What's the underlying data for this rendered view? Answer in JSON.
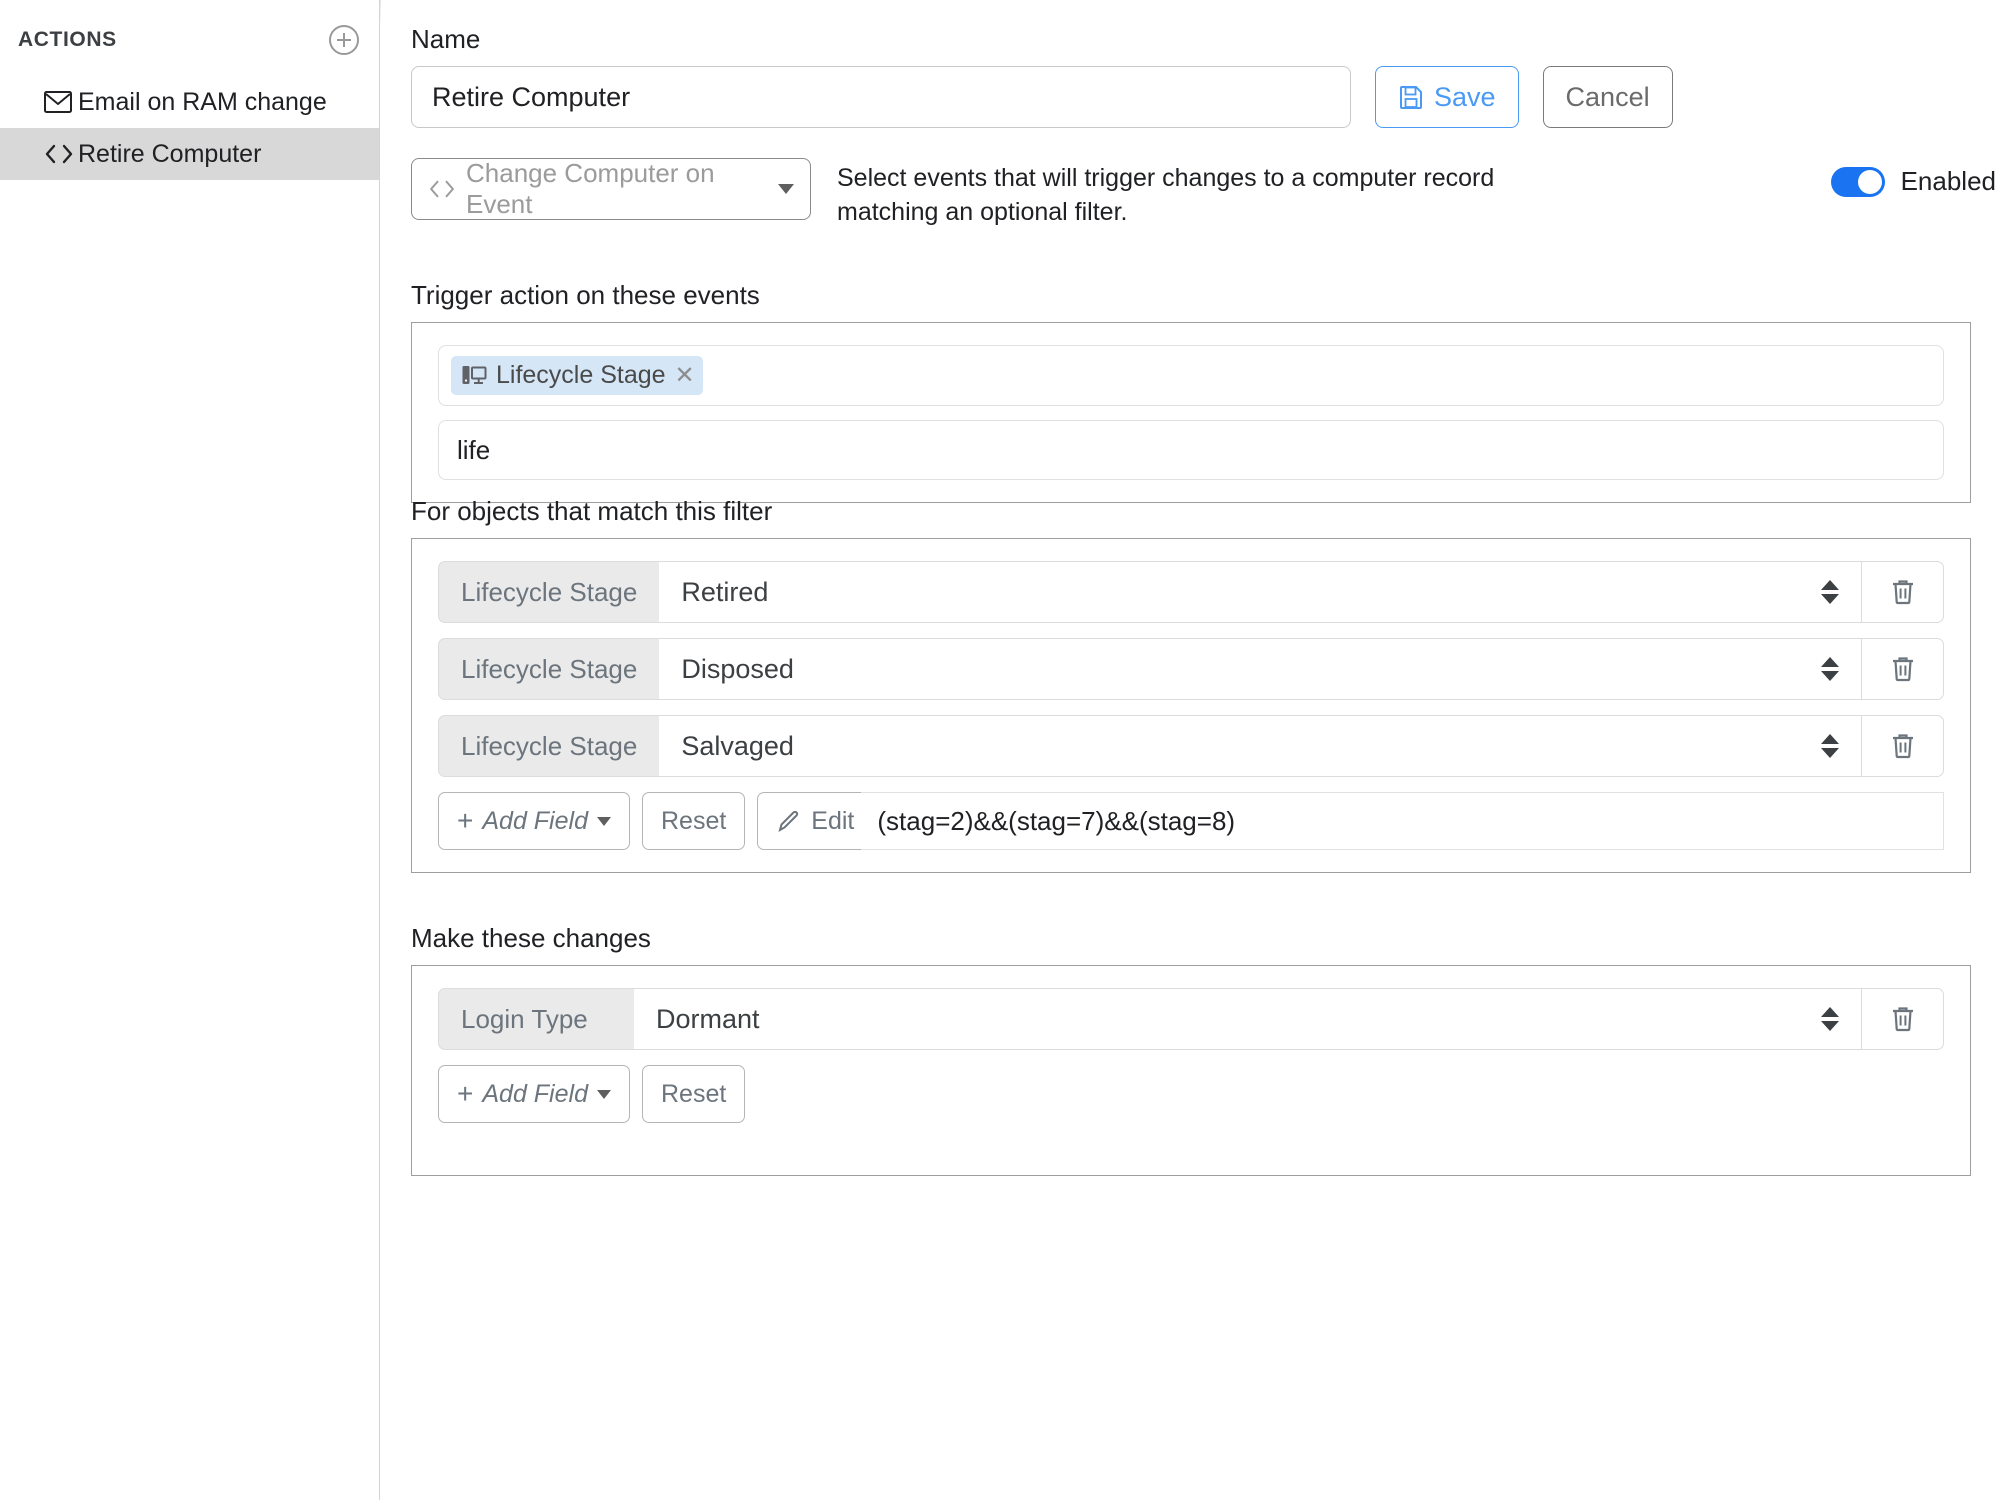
{
  "sidebar": {
    "title": "ACTIONS",
    "add_icon": "plus-circle-icon",
    "items": [
      {
        "label": "Email on RAM change",
        "icon": "envelope-icon",
        "selected": false
      },
      {
        "label": "Retire Computer",
        "icon": "code-brackets-icon",
        "selected": true
      }
    ]
  },
  "name_section": {
    "label": "Name",
    "value": "Retire Computer",
    "placeholder": "Name",
    "save_label": "Save",
    "save_icon": "floppy-disk-icon",
    "cancel_label": "Cancel"
  },
  "type_row": {
    "type_label": "Change Computer on Event",
    "type_icon": "code-brackets-icon",
    "caret_icon": "chevron-down-icon",
    "description_line1": "Select events that will trigger changes to a computer record",
    "description_line2": "matching an optional filter.",
    "toggle_label": "Enabled",
    "toggle_on": true,
    "toggle_color": "#1a73f0"
  },
  "events_section": {
    "label": "Trigger action on these events",
    "tags": [
      {
        "label": "Lifecycle Stage",
        "icon": "computer-icon",
        "remove_icon": "close-icon"
      }
    ],
    "search_value": "life",
    "search_placeholder": "Search events"
  },
  "filter_section": {
    "label": "For objects that match this filter",
    "rows": [
      {
        "field": "Lifecycle Stage",
        "value": "Retired",
        "delete_icon": "trash-icon",
        "stepper_icon": "stepper-icon"
      },
      {
        "field": "Lifecycle Stage",
        "value": "Disposed",
        "delete_icon": "trash-icon",
        "stepper_icon": "stepper-icon"
      },
      {
        "field": "Lifecycle Stage",
        "value": "Salvaged",
        "delete_icon": "trash-icon",
        "stepper_icon": "stepper-icon"
      }
    ],
    "add_field_label": "Add Field",
    "reset_label": "Reset",
    "edit_label": "Edit",
    "edit_icon": "pencil-icon",
    "expression": "(stag=2)&&(stag=7)&&(stag=8)"
  },
  "changes_section": {
    "label": "Make these changes",
    "rows": [
      {
        "field": "Login Type",
        "value": "Dormant",
        "delete_icon": "trash-icon",
        "stepper_icon": "stepper-icon"
      }
    ],
    "add_field_label": "Add Field",
    "reset_label": "Reset"
  }
}
